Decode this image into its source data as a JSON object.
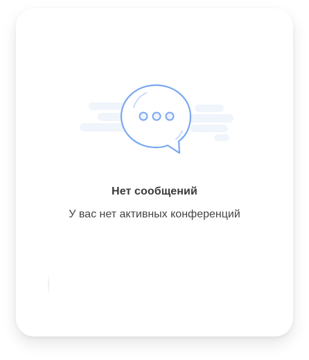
{
  "empty_state": {
    "title": "Нет сообщений",
    "subtitle": "У вас нет активных конференций",
    "illustration_icon": "chat-bubble-icon"
  },
  "colors": {
    "accent": "#7aa7f0",
    "cloud": "#f0f4fb",
    "title_text": "#3a3a3a",
    "subtitle_text": "#444444"
  }
}
